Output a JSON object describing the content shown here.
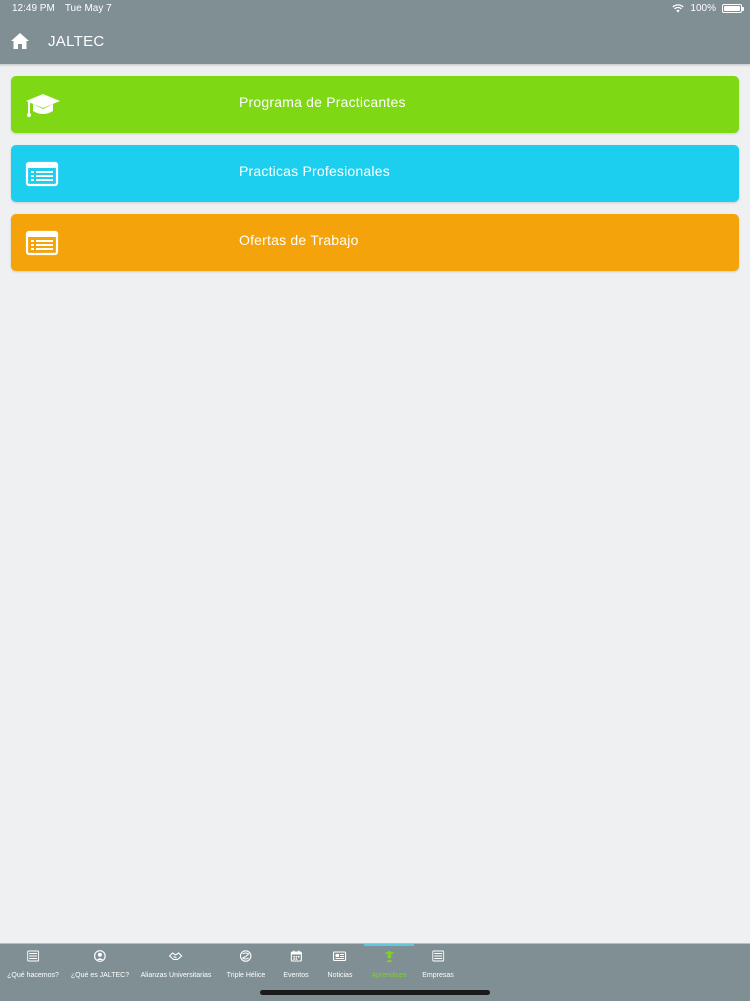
{
  "status": {
    "time": "12:49 PM",
    "date": "Tue May 7",
    "battery": "100%",
    "battery_level": 1.0
  },
  "nav": {
    "title": "JALTEC",
    "home_icon": "home-icon"
  },
  "menu": [
    {
      "label": "Programa de Practicantes",
      "color": "#7ed814",
      "icon": "graduation-cap-icon"
    },
    {
      "label": "Practicas Profesionales",
      "color": "#1dcfee",
      "icon": "list-card-icon"
    },
    {
      "label": "Ofertas de Trabajo",
      "color": "#f5a30a",
      "icon": "list-card-icon"
    }
  ],
  "tabs": [
    {
      "label": "¿Qué hacemos?",
      "icon": "list-icon",
      "active": false
    },
    {
      "label": "¿Qué es JALTEC?",
      "icon": "user-circle-icon",
      "active": false
    },
    {
      "label": "Alianzas Universitarias",
      "icon": "handshake-icon",
      "active": false
    },
    {
      "label": "Triple Hélice",
      "icon": "helix-icon",
      "active": false
    },
    {
      "label": "Eventos",
      "icon": "calendar-icon",
      "active": false
    },
    {
      "label": "Noticias",
      "icon": "newspaper-icon",
      "active": false
    },
    {
      "label": "Aprendices",
      "icon": "graduate-icon",
      "active": true
    },
    {
      "label": "Empresas",
      "icon": "list-icon",
      "active": false
    }
  ],
  "colors": {
    "header": "#7f8f93",
    "background": "#eef0f1",
    "active_tab": "#7ed321"
  }
}
